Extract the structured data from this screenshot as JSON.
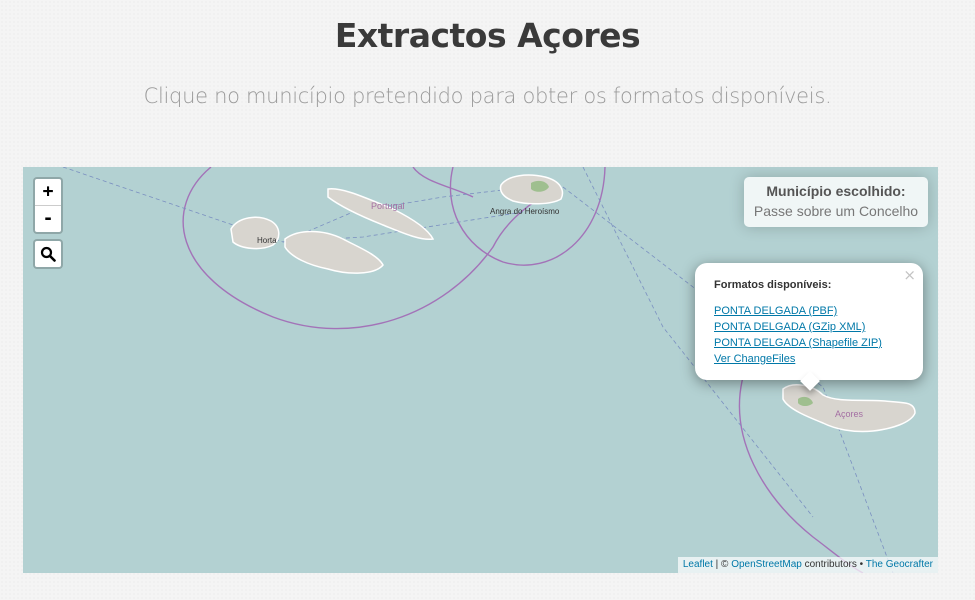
{
  "page": {
    "title": "Extractos Açores",
    "subtitle": "Clique no município pretendido para obter os formatos disponíveis."
  },
  "map": {
    "water_color": "#b3d1d2",
    "land_color": "#d8d5cf",
    "border_color": "#a373b8",
    "zoom_in_label": "+",
    "zoom_out_label": "-",
    "labels": {
      "horta": "Horta",
      "portugal": "Portugal",
      "angra": "Angra do Heroísmo",
      "acores": "Açores"
    }
  },
  "info_box": {
    "title": "Município escolhido:",
    "hint": "Passe sobre um Concelho"
  },
  "popup": {
    "close": "×",
    "title": "Formatos disponíveis:",
    "links": [
      "PONTA DELGADA (PBF)",
      "PONTA DELGADA (GZip XML)",
      "PONTA DELGADA (Shapefile ZIP)",
      "Ver ChangeFiles"
    ]
  },
  "attribution": {
    "leaflet": "Leaflet",
    "separator": " | © ",
    "osm": "OpenStreetMap",
    "contributors": " contributors • ",
    "geocrafter": "The Geocrafter"
  }
}
